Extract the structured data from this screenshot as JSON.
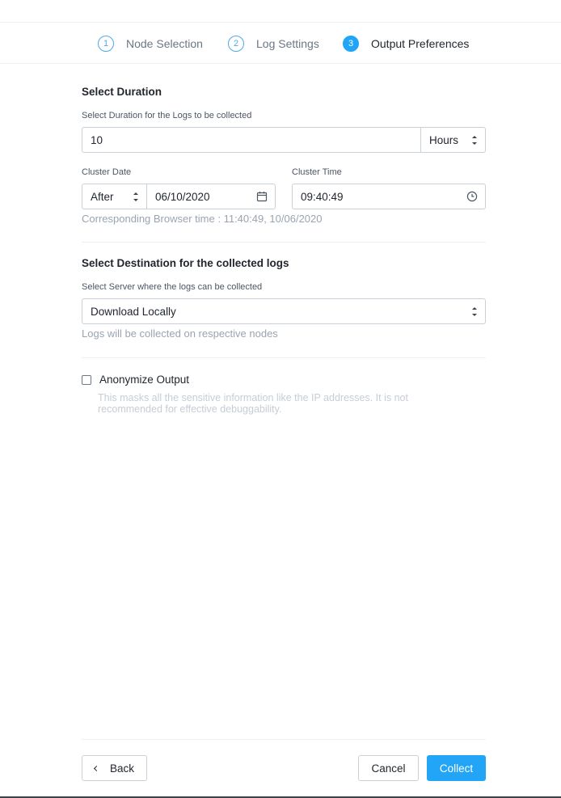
{
  "stepper": {
    "steps": [
      {
        "number": "1",
        "label": "Node Selection",
        "active": false
      },
      {
        "number": "2",
        "label": "Log Settings",
        "active": false
      },
      {
        "number": "3",
        "label": "Output Preferences",
        "active": true
      }
    ]
  },
  "duration": {
    "heading": "Select Duration",
    "sublabel": "Select Duration for the Logs to be collected",
    "value": "10",
    "unit": "Hours",
    "cluster_date_label": "Cluster Date",
    "cluster_time_label": "Cluster Time",
    "relation": "After",
    "date": "06/10/2020",
    "time": "09:40:49",
    "browser_time_hint": "Corresponding Browser time : 11:40:49, 10/06/2020"
  },
  "destination": {
    "heading": "Select Destination for the collected logs",
    "sublabel": "Select Server where the logs can be collected",
    "selected": "Download Locally",
    "hint": "Logs will be collected on respective nodes"
  },
  "anonymize": {
    "label": "Anonymize Output",
    "checked": false,
    "description": "This masks all the sensitive information like the IP addresses. It is not recommended for effective debuggability."
  },
  "footer": {
    "back_label": "Back",
    "cancel_label": "Cancel",
    "collect_label": "Collect"
  },
  "icons": {
    "calendar": "calendar-icon",
    "clock": "clock-icon",
    "back_chevron": "chevron-left-icon"
  },
  "colors": {
    "accent": "#22a5f7",
    "border": "#c9d0d8",
    "text": "#22272e",
    "muted": "#9aa4b0"
  }
}
